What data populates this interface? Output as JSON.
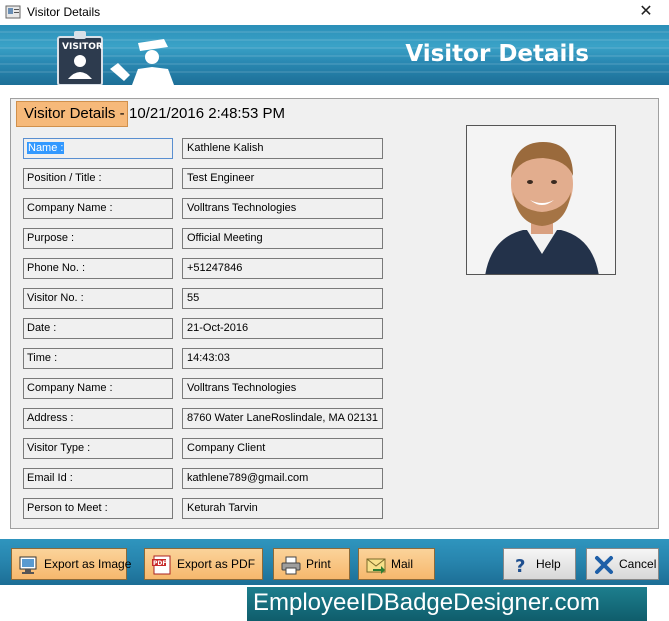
{
  "window": {
    "title": "Visitor Details",
    "close_glyph": "✕"
  },
  "header": {
    "title": "Visitor Details",
    "logo_badge_text": "VISITOR"
  },
  "section": {
    "badge": "Visitor Details -",
    "datetime": "10/21/2016 2:48:53 PM"
  },
  "fields": [
    {
      "label": "Name :",
      "value": "Kathlene Kalish"
    },
    {
      "label": "Position / Title :",
      "value": "Test Engineer"
    },
    {
      "label": "Company Name :",
      "value": "Volltrans Technologies"
    },
    {
      "label": "Purpose :",
      "value": "Official Meeting"
    },
    {
      "label": "Phone No. :",
      "value": "+51247846"
    },
    {
      "label": "Visitor No. :",
      "value": "55"
    },
    {
      "label": "Date :",
      "value": "21-Oct-2016"
    },
    {
      "label": "Time :",
      "value": "14:43:03"
    },
    {
      "label": "Company Name :",
      "value": "Volltrans Technologies"
    },
    {
      "label": "Address :",
      "value": "8760 Water LaneRoslindale, MA 02131"
    },
    {
      "label": "Visitor Type :",
      "value": "Company Client"
    },
    {
      "label": "Email Id :",
      "value": "kathlene789@gmail.com"
    },
    {
      "label": "Person to Meet :",
      "value": "Keturah Tarvin"
    }
  ],
  "buttons": {
    "export_image": "Export as Image",
    "export_pdf": "Export as PDF",
    "print": "Print",
    "mail": "Mail",
    "help": "Help",
    "cancel": "Cancel",
    "pdf_icon_text": "PDF"
  },
  "footer": {
    "brand": "EmployeeIDBadgeDesigner.com"
  },
  "colors": {
    "banner": "#2a8ab4",
    "badge": "#f6b97a",
    "footer": "#15707f",
    "button_orange": "#f6b86d"
  }
}
